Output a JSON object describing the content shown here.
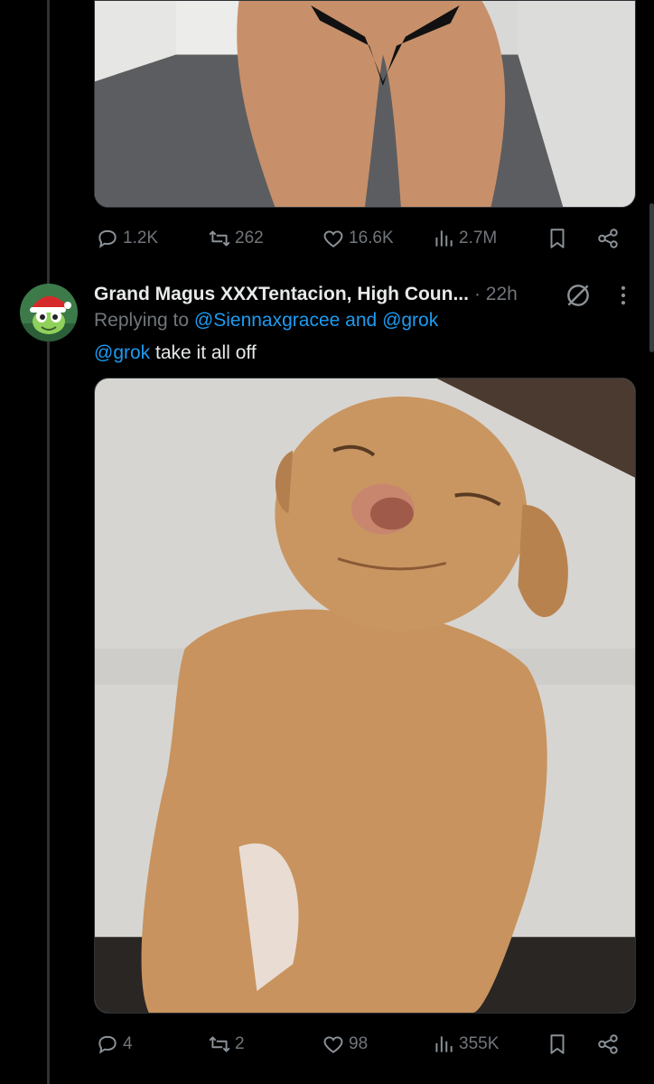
{
  "tweet1": {
    "media_icon": "photo",
    "actions": {
      "replies": "1.2K",
      "retweets": "262",
      "likes": "16.6K",
      "views": "2.7M"
    }
  },
  "tweet2": {
    "author": {
      "display_name": "Grand Magus XXXTentacion, High Coun...",
      "avatar_icon": "frog-santa-hat-avatar"
    },
    "time": "· 22h",
    "replying_to": {
      "prefix": "Replying to",
      "user1": "@Siennaxgracee",
      "connector": "and",
      "user2": "@grok"
    },
    "text": {
      "mention": "@grok",
      "body": "take it all off"
    },
    "media_icon": "photo-dog",
    "actions": {
      "replies": "4",
      "retweets": "2",
      "likes": "98",
      "views": "355K"
    }
  },
  "colors": {
    "background": "#000000",
    "text": "#e7e9ea",
    "muted": "#71767b",
    "link": "#1d9bf0"
  }
}
